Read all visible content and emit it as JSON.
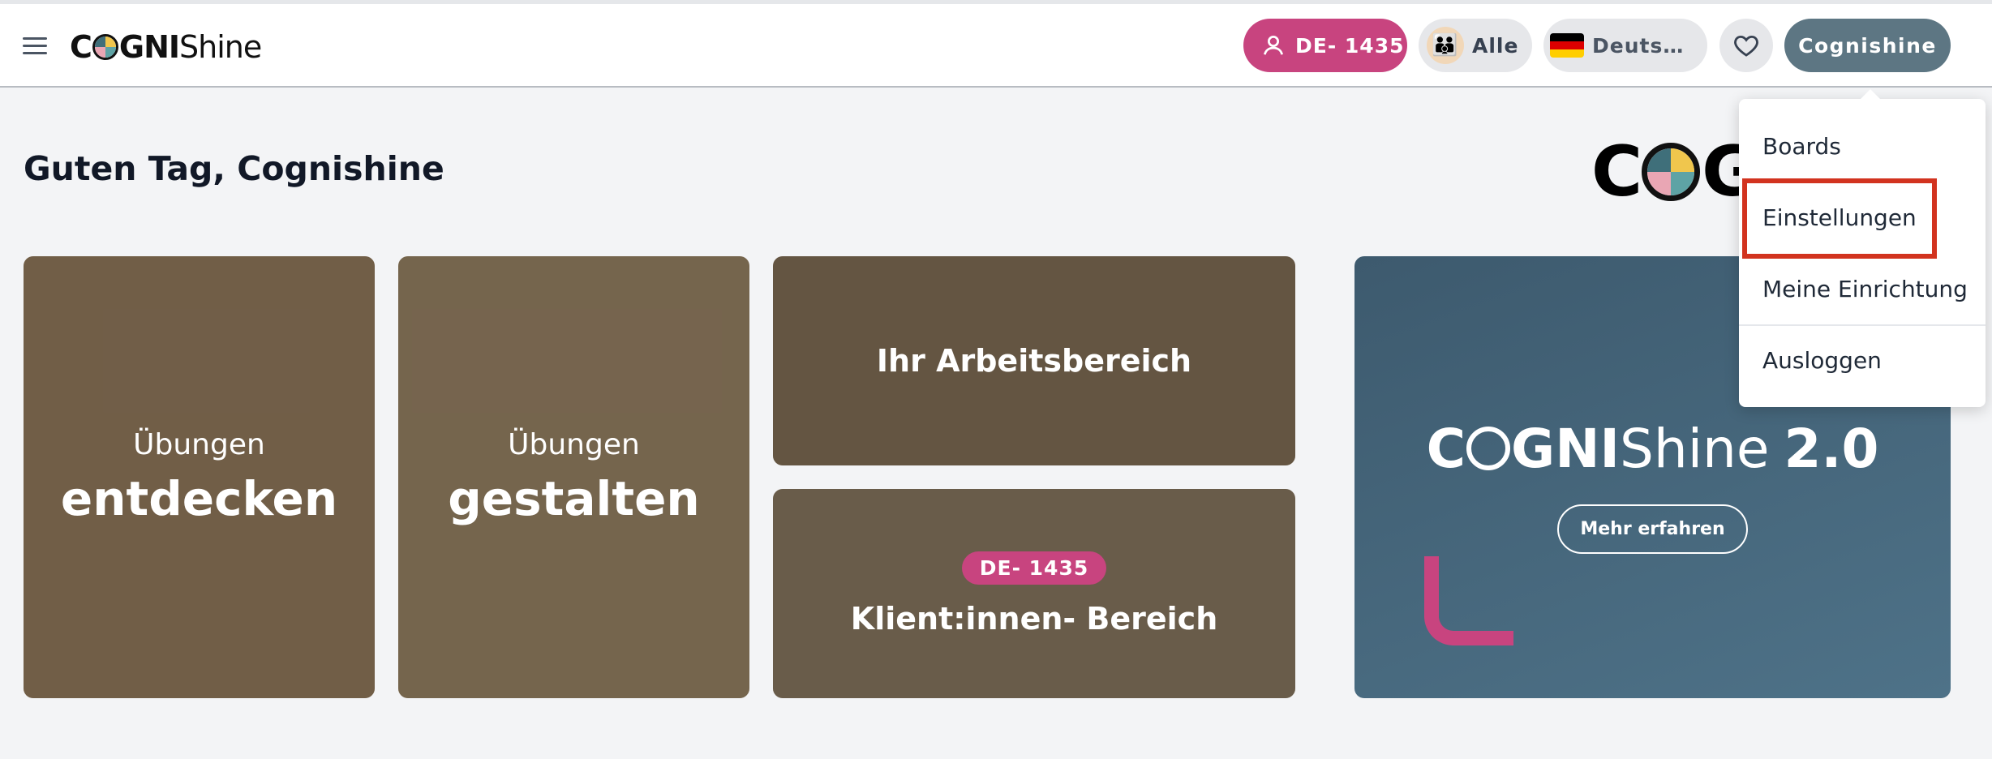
{
  "header": {
    "logo": {
      "part1": "C",
      "part2": "GNI",
      "part3": "Shine"
    },
    "client_pill": "DE- 1435",
    "group_pill": "Alle",
    "language_pill": "Deuts…",
    "user_button": "Cognishine"
  },
  "main": {
    "greeting": "Guten Tag, Cognishine",
    "big_logo": {
      "part1": "C",
      "part2": "GN"
    },
    "cards": {
      "entdecken": {
        "sub": "Übungen",
        "main": "entdecken"
      },
      "gestalten": {
        "sub": "Übungen",
        "main": "gestalten"
      },
      "arbeitsbereich": {
        "label": "Ihr Arbeitsbereich"
      },
      "klient": {
        "badge": "DE- 1435",
        "label": "Klient:innen- Bereich"
      }
    },
    "promo": {
      "part1": "C",
      "part2": "GNI",
      "part3": "Shine",
      "version": "2.0",
      "button": "Mehr erfahren"
    }
  },
  "dropdown": {
    "items": [
      "Boards",
      "Einstellungen",
      "Meine Einrichtung",
      "Ausloggen"
    ]
  },
  "colors": {
    "accent_pink": "#c8447f",
    "user_button": "#5d7683",
    "highlight": "#d2331f",
    "promo_bg": "#3d5a6e"
  },
  "icons": [
    "menu-icon",
    "user-icon",
    "family-icon",
    "german-flag-icon",
    "heart-icon"
  ]
}
